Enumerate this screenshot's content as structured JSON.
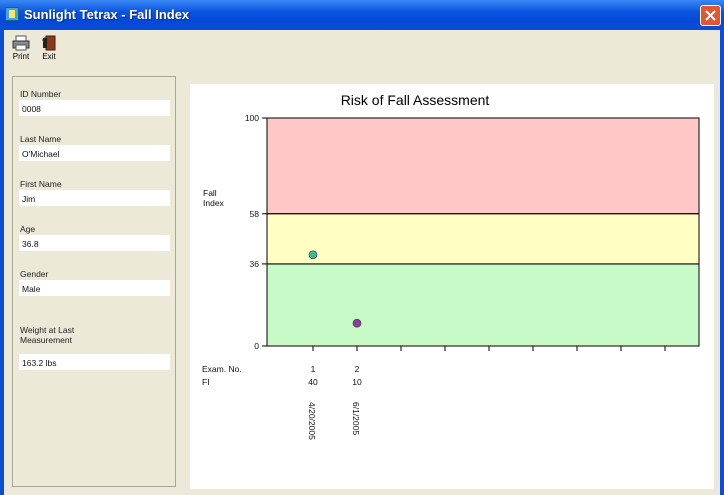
{
  "window": {
    "title": "Sunlight Tetrax - Fall Index"
  },
  "toolbar": {
    "print_label": "Print",
    "exit_label": "Exit"
  },
  "fields": [
    {
      "label": "ID Number",
      "value": "0008"
    },
    {
      "label": "Last Name",
      "value": "O'Michael"
    },
    {
      "label": "First Name",
      "value": "Jim"
    },
    {
      "label": "Age",
      "value": "36.8"
    },
    {
      "label": "Gender",
      "value": "Male"
    },
    {
      "label": "Weight at Last Measurement",
      "value": "163.2 lbs"
    }
  ],
  "chart_data": {
    "type": "scatter",
    "title": "Risk of Fall Assessment",
    "ylabel": "Fall Index",
    "ylim": [
      0,
      100
    ],
    "yticks": [
      0,
      36,
      58,
      100
    ],
    "bands": [
      {
        "from": 58,
        "to": 100,
        "color": "#FFC8C8"
      },
      {
        "from": 36,
        "to": 58,
        "color": "#FFFFC4"
      },
      {
        "from": 0,
        "to": 36,
        "color": "#C8FAC8"
      }
    ],
    "grid": false,
    "table_labels": {
      "exam": "Exam. No.",
      "fi": "FI"
    },
    "points": [
      {
        "exam": "1",
        "fi": 40,
        "date": "4/20/2005",
        "color": "#3BB89A"
      },
      {
        "exam": "2",
        "fi": 10,
        "date": "6/1/2005",
        "color": "#8A3F9A"
      }
    ]
  }
}
